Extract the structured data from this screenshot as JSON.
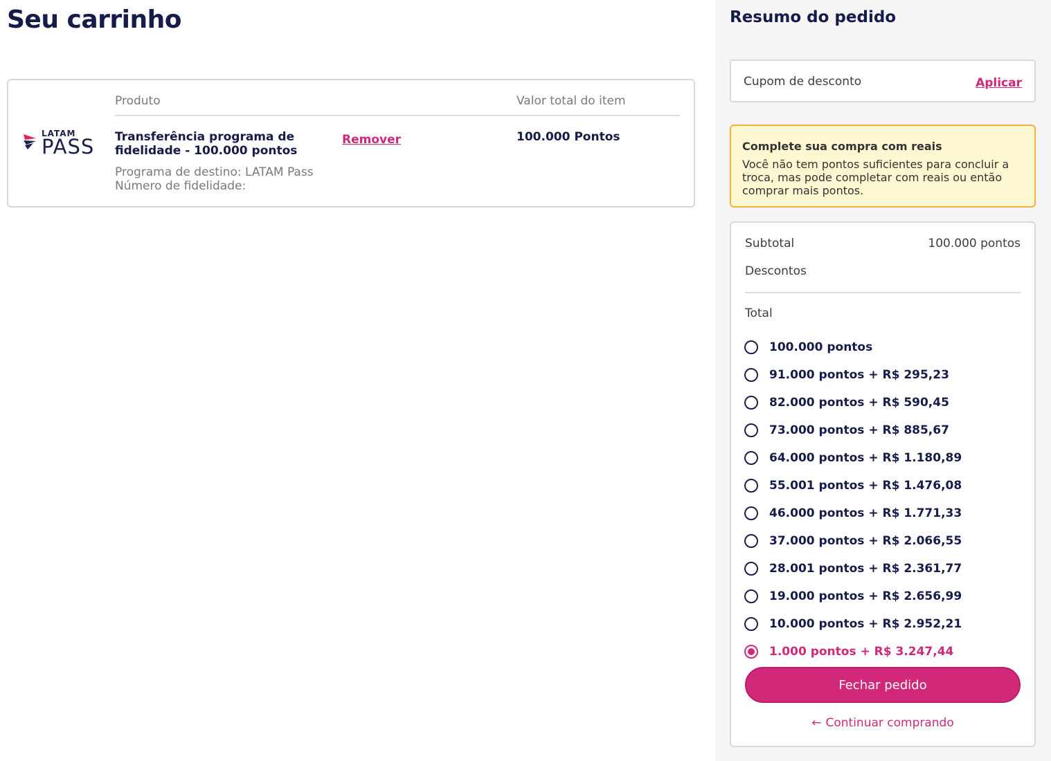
{
  "cart": {
    "title": "Seu carrinho",
    "headers": {
      "product": "Produto",
      "value": "Valor total do item"
    },
    "logo": {
      "top": "LATAM",
      "bottom": "PASS"
    },
    "item": {
      "name": "Transferência programa de fidelidade - 100.000 pontos",
      "destination": "Programa de destino: LATAM Pass",
      "loyalty_number": "Número de fidelidade:",
      "remove_label": "Remover",
      "value": "100.000 Pontos"
    }
  },
  "summary": {
    "title": "Resumo do pedido",
    "coupon": {
      "label": "Cupom de desconto",
      "apply_label": "Aplicar"
    },
    "alert": {
      "title": "Complete sua compra com reais",
      "text": "Você não tem pontos suficientes para concluir a troca, mas pode completar com reais ou então comprar mais pontos."
    },
    "subtotal_label": "Subtotal",
    "subtotal_value": "100.000 pontos",
    "discounts_label": "Descontos",
    "total_label": "Total",
    "options": [
      {
        "label": "100.000 pontos",
        "selected": false
      },
      {
        "label": "91.000 pontos + R$ 295,23",
        "selected": false
      },
      {
        "label": "82.000 pontos + R$ 590,45",
        "selected": false
      },
      {
        "label": "73.000 pontos + R$ 885,67",
        "selected": false
      },
      {
        "label": "64.000 pontos + R$ 1.180,89",
        "selected": false
      },
      {
        "label": "55.001 pontos + R$ 1.476,08",
        "selected": false
      },
      {
        "label": "46.000 pontos + R$ 1.771,33",
        "selected": false
      },
      {
        "label": "37.000 pontos + R$ 2.066,55",
        "selected": false
      },
      {
        "label": "28.001 pontos + R$ 2.361,77",
        "selected": false
      },
      {
        "label": "19.000 pontos + R$ 2.656,99",
        "selected": false
      },
      {
        "label": "10.000 pontos + R$ 2.952,21",
        "selected": false
      },
      {
        "label": "1.000 pontos + R$ 3.247,44",
        "selected": true
      }
    ],
    "checkout_label": "Fechar pedido",
    "continue_label": "Continuar comprando",
    "continue_icon": "arrow-left-icon"
  },
  "colors": {
    "brand_pink": "#d2287a",
    "navy": "#151c4a",
    "alert_bg": "#fdf7d2",
    "alert_border": "#f0b43a",
    "sidebar_bg": "#f5f5f5"
  }
}
